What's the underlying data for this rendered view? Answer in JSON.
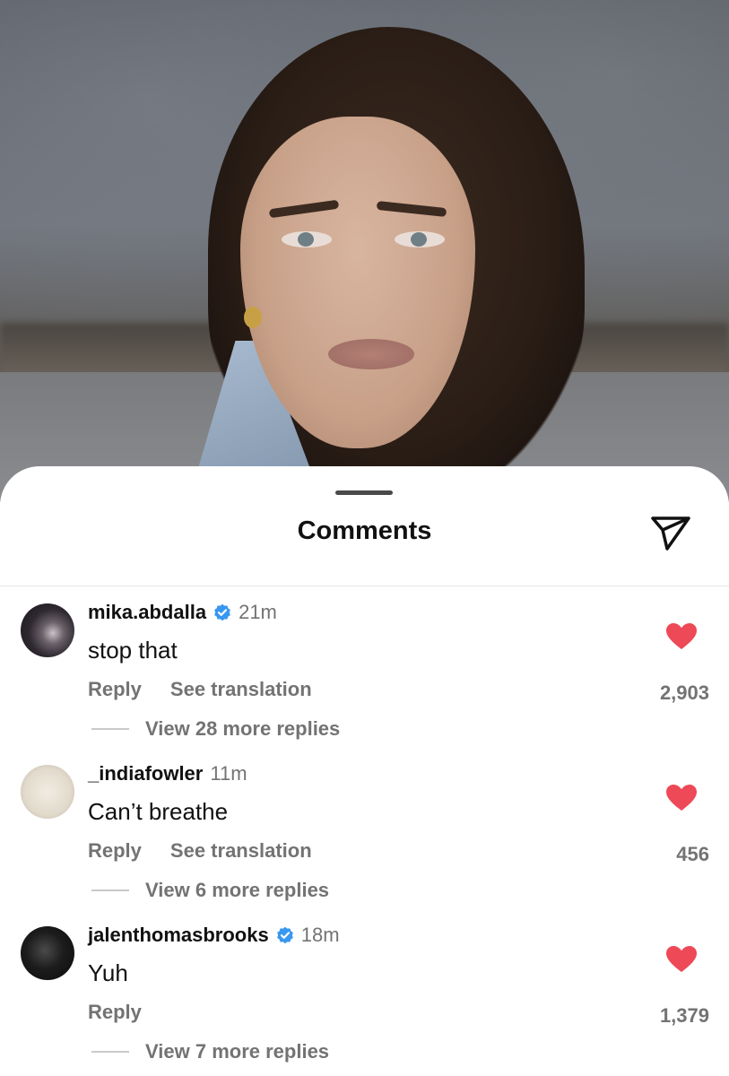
{
  "sheet": {
    "title": "Comments",
    "send_icon": "send-paper-plane-icon"
  },
  "colors": {
    "like": "#ed4956",
    "verified": "#3897f0",
    "secondary_text": "#737373"
  },
  "comments": [
    {
      "username": "mika.abdalla",
      "verified": true,
      "time": "21m",
      "text": "stop that",
      "reply_label": "Reply",
      "translate_label": "See translation",
      "likes": "2,903",
      "liked": true,
      "view_replies": "View 28 more replies"
    },
    {
      "username": "_indiafowler",
      "verified": false,
      "time": "11m",
      "text": "Can’t breathe",
      "reply_label": "Reply",
      "translate_label": "See translation",
      "likes": "456",
      "liked": true,
      "view_replies": "View 6 more replies"
    },
    {
      "username": "jalenthomasbrooks",
      "verified": true,
      "time": "18m",
      "text": "Yuh",
      "reply_label": "Reply",
      "likes": "1,379",
      "liked": true,
      "view_replies": "View 7 more replies"
    }
  ]
}
